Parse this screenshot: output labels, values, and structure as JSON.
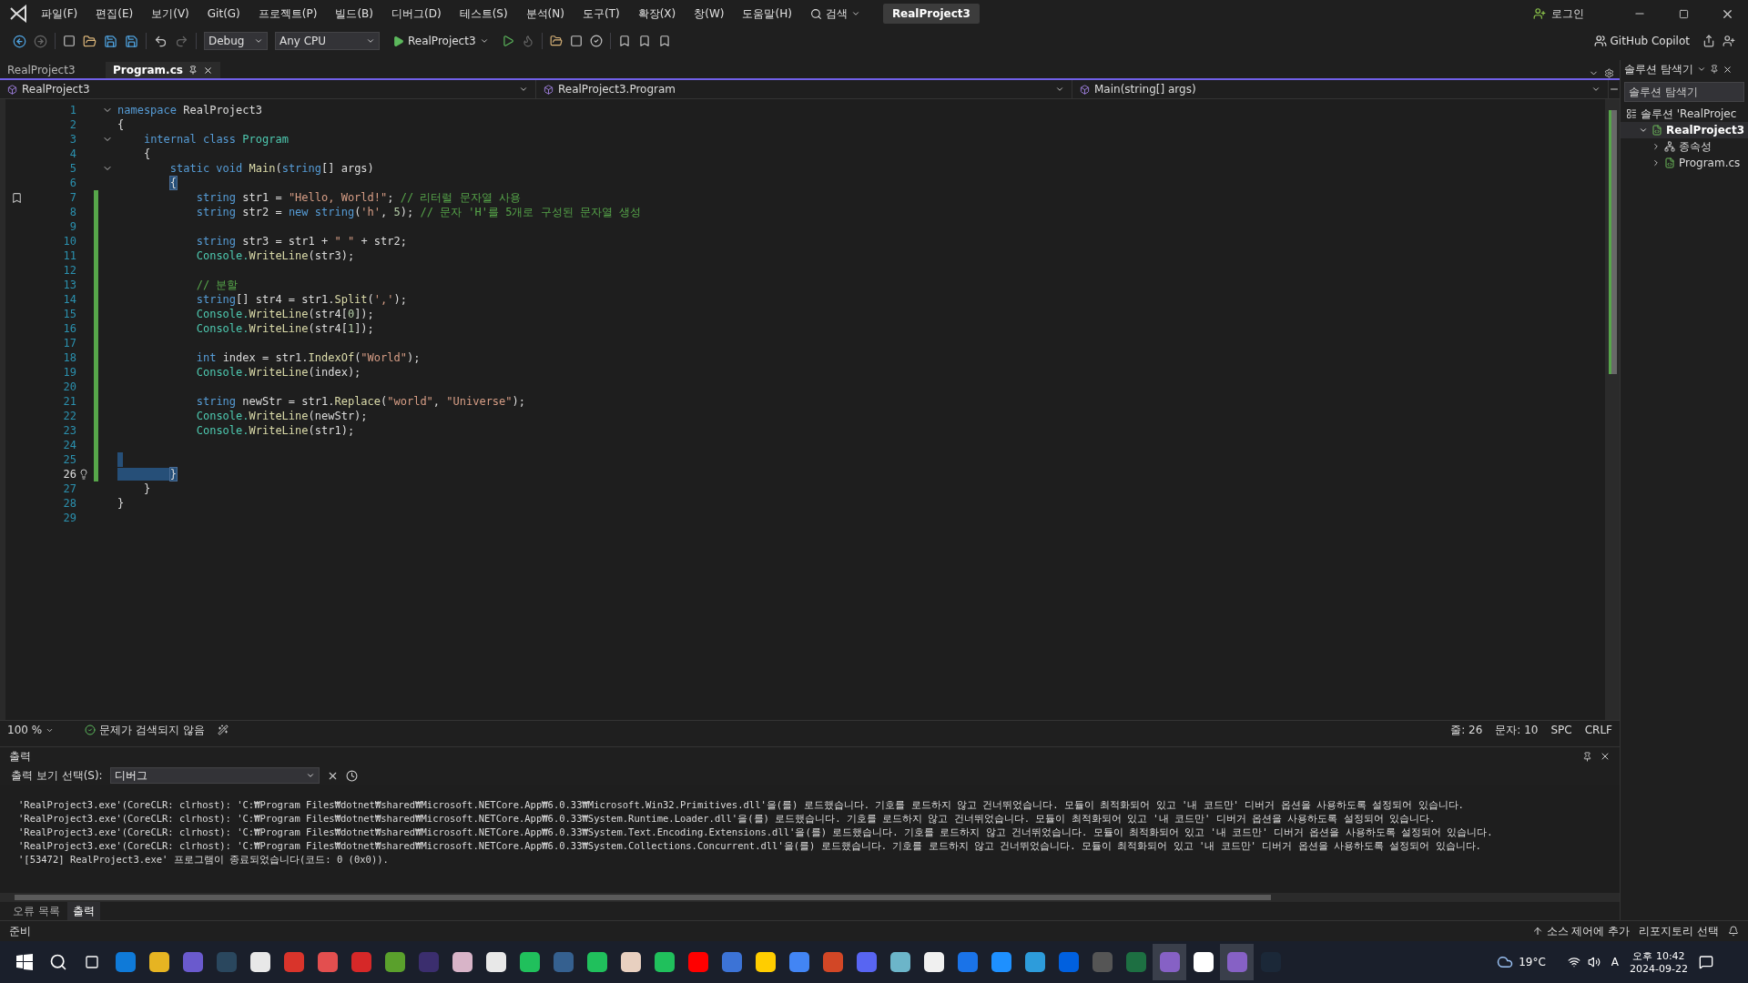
{
  "window": {
    "title": "RealProject3",
    "login": "로그인"
  },
  "menu": [
    "파일(F)",
    "편집(E)",
    "보기(V)",
    "Git(G)",
    "프로젝트(P)",
    "빌드(B)",
    "디버그(D)",
    "테스트(S)",
    "분석(N)",
    "도구(T)",
    "확장(X)",
    "창(W)",
    "도움말(H)"
  ],
  "search": {
    "label": "검색"
  },
  "toolbar": {
    "configuration": "Debug",
    "platform": "Any CPU",
    "run_target": "RealProject3",
    "copilot": "GitHub Copilot"
  },
  "doc_tabs": [
    {
      "label": "RealProject3",
      "selected": false
    },
    {
      "label": "Program.cs",
      "selected": true
    }
  ],
  "nav_bar": [
    "RealProject3",
    "RealProject3.Program",
    "Main(string[] args)"
  ],
  "code_lines": [
    {
      "n": "1",
      "changed": false,
      "selected": false,
      "foldable": true,
      "bookmark": false,
      "lightbulb": false,
      "tokens": [
        {
          "kind": "kw",
          "text": "namespace"
        },
        {
          "kind": "plain",
          "text": " RealProject3"
        }
      ]
    },
    {
      "n": "2",
      "changed": false,
      "selected": false,
      "foldable": false,
      "bookmark": false,
      "lightbulb": false,
      "tokens": [
        {
          "kind": "plain",
          "text": "{"
        }
      ]
    },
    {
      "n": "3",
      "changed": false,
      "selected": false,
      "foldable": true,
      "bookmark": false,
      "lightbulb": false,
      "tokens": [
        {
          "kind": "kw",
          "text": "    internal class"
        },
        {
          "kind": "type",
          "text": " Program"
        }
      ]
    },
    {
      "n": "4",
      "changed": false,
      "selected": false,
      "foldable": false,
      "bookmark": false,
      "lightbulb": false,
      "tokens": [
        {
          "kind": "plain",
          "text": "    {"
        }
      ]
    },
    {
      "n": "5",
      "changed": false,
      "selected": false,
      "foldable": true,
      "bookmark": false,
      "lightbulb": false,
      "tokens": [
        {
          "kind": "kw",
          "text": "        static void"
        },
        {
          "kind": "method",
          "text": " Main"
        },
        {
          "kind": "plain",
          "text": "("
        },
        {
          "kind": "kw",
          "text": "string"
        },
        {
          "kind": "plain",
          "text": "[] args)"
        }
      ]
    },
    {
      "n": "6",
      "changed": false,
      "selected": false,
      "foldable": false,
      "bookmark": false,
      "lightbulb": false,
      "tokens": [
        {
          "kind": "brace-match",
          "text": "        {"
        }
      ]
    },
    {
      "n": "7",
      "changed": true,
      "selected": false,
      "foldable": false,
      "bookmark": true,
      "lightbulb": false,
      "tokens": [
        {
          "kind": "kw",
          "text": "            string"
        },
        {
          "kind": "plain",
          "text": " str1 = "
        },
        {
          "kind": "str",
          "text": "\"Hello, World!\""
        },
        {
          "kind": "plain",
          "text": "; "
        },
        {
          "kind": "comment",
          "text": "// 리터럴 문자열 사용"
        }
      ]
    },
    {
      "n": "8",
      "changed": true,
      "selected": false,
      "foldable": false,
      "bookmark": false,
      "lightbulb": false,
      "tokens": [
        {
          "kind": "kw",
          "text": "            string"
        },
        {
          "kind": "plain",
          "text": " str2 = "
        },
        {
          "kind": "kw",
          "text": "new string"
        },
        {
          "kind": "plain",
          "text": "("
        },
        {
          "kind": "str",
          "text": "'h'"
        },
        {
          "kind": "plain",
          "text": ", "
        },
        {
          "kind": "num",
          "text": "5"
        },
        {
          "kind": "plain",
          "text": "); "
        },
        {
          "kind": "comment",
          "text": "// 문자 'H'를 5개로 구성된 문자열 생성"
        }
      ]
    },
    {
      "n": "9",
      "changed": true,
      "selected": false,
      "foldable": false,
      "bookmark": false,
      "lightbulb": false
    },
    {
      "n": "10",
      "changed": true,
      "selected": false,
      "foldable": false,
      "bookmark": false,
      "lightbulb": false,
      "tokens": [
        {
          "kind": "kw",
          "text": "            string"
        },
        {
          "kind": "plain",
          "text": " str3 = str1 + "
        },
        {
          "kind": "str",
          "text": "\" \""
        },
        {
          "kind": "plain",
          "text": " + str2;"
        }
      ]
    },
    {
      "n": "11",
      "changed": true,
      "selected": false,
      "foldable": false,
      "bookmark": false,
      "lightbulb": false,
      "tokens": [
        {
          "kind": "type",
          "text": "            Console."
        },
        {
          "kind": "method",
          "text": "WriteLine"
        },
        {
          "kind": "plain",
          "text": "(str3);"
        }
      ]
    },
    {
      "n": "12",
      "changed": true,
      "selected": false,
      "foldable": false,
      "bookmark": false,
      "lightbulb": false
    },
    {
      "n": "13",
      "changed": true,
      "selected": false,
      "foldable": false,
      "bookmark": false,
      "lightbulb": false,
      "tokens": [
        {
          "kind": "comment",
          "text": "            // 분할"
        }
      ]
    },
    {
      "n": "14",
      "changed": true,
      "selected": false,
      "foldable": false,
      "bookmark": false,
      "lightbulb": false,
      "tokens": [
        {
          "kind": "kw",
          "text": "            string"
        },
        {
          "kind": "plain",
          "text": "[] str4 = str1."
        },
        {
          "kind": "method",
          "text": "Split"
        },
        {
          "kind": "plain",
          "text": "("
        },
        {
          "kind": "str",
          "text": "','"
        },
        {
          "kind": "plain",
          "text": ");"
        }
      ]
    },
    {
      "n": "15",
      "changed": true,
      "selected": false,
      "foldable": false,
      "bookmark": false,
      "lightbulb": false,
      "tokens": [
        {
          "kind": "type",
          "text": "            Console."
        },
        {
          "kind": "method",
          "text": "WriteLine"
        },
        {
          "kind": "plain",
          "text": "(str4["
        },
        {
          "kind": "num",
          "text": "0"
        },
        {
          "kind": "plain",
          "text": "]);"
        }
      ]
    },
    {
      "n": "16",
      "changed": true,
      "selected": false,
      "foldable": false,
      "bookmark": false,
      "lightbulb": false,
      "tokens": [
        {
          "kind": "type",
          "text": "            Console."
        },
        {
          "kind": "method",
          "text": "WriteLine"
        },
        {
          "kind": "plain",
          "text": "(str4["
        },
        {
          "kind": "num",
          "text": "1"
        },
        {
          "kind": "plain",
          "text": "]);"
        }
      ]
    },
    {
      "n": "17",
      "changed": true,
      "selected": false,
      "foldable": false,
      "bookmark": false,
      "lightbulb": false
    },
    {
      "n": "18",
      "changed": true,
      "selected": false,
      "foldable": false,
      "bookmark": false,
      "lightbulb": false,
      "tokens": [
        {
          "kind": "kw",
          "text": "            int"
        },
        {
          "kind": "plain",
          "text": " index = str1."
        },
        {
          "kind": "method",
          "text": "IndexOf"
        },
        {
          "kind": "plain",
          "text": "("
        },
        {
          "kind": "str",
          "text": "\"World\""
        },
        {
          "kind": "plain",
          "text": ");"
        }
      ]
    },
    {
      "n": "19",
      "changed": true,
      "selected": false,
      "foldable": false,
      "bookmark": false,
      "lightbulb": false,
      "tokens": [
        {
          "kind": "type",
          "text": "            Console."
        },
        {
          "kind": "method",
          "text": "WriteLine"
        },
        {
          "kind": "plain",
          "text": "(index);"
        }
      ]
    },
    {
      "n": "20",
      "changed": true,
      "selected": false,
      "foldable": false,
      "bookmark": false,
      "lightbulb": false
    },
    {
      "n": "21",
      "changed": true,
      "selected": false,
      "foldable": false,
      "bookmark": false,
      "lightbulb": false,
      "tokens": [
        {
          "kind": "kw",
          "text": "            string"
        },
        {
          "kind": "plain",
          "text": " newStr = str1."
        },
        {
          "kind": "method",
          "text": "Replace"
        },
        {
          "kind": "plain",
          "text": "("
        },
        {
          "kind": "str",
          "text": "\"world\""
        },
        {
          "kind": "plain",
          "text": ", "
        },
        {
          "kind": "str",
          "text": "\"Universe\""
        },
        {
          "kind": "plain",
          "text": ");"
        }
      ]
    },
    {
      "n": "22",
      "changed": true,
      "selected": false,
      "foldable": false,
      "bookmark": false,
      "lightbulb": false,
      "tokens": [
        {
          "kind": "type",
          "text": "            Console."
        },
        {
          "kind": "method",
          "text": "WriteLine"
        },
        {
          "kind": "plain",
          "text": "(newStr);"
        }
      ]
    },
    {
      "n": "23",
      "changed": true,
      "selected": false,
      "foldable": false,
      "bookmark": false,
      "lightbulb": false,
      "tokens": [
        {
          "kind": "type",
          "text": "            Console."
        },
        {
          "kind": "method",
          "text": "WriteLine"
        },
        {
          "kind": "plain",
          "text": "(str1);"
        }
      ]
    },
    {
      "n": "24",
      "changed": true,
      "selected": false,
      "foldable": false,
      "bookmark": false,
      "lightbulb": false
    },
    {
      "n": "25",
      "changed": true,
      "selected": true,
      "foldable": false,
      "bookmark": false,
      "lightbulb": false
    },
    {
      "n": "26",
      "changed": true,
      "selected": true,
      "foldable": false,
      "bookmark": false,
      "lightbulb": true,
      "tokens": [
        {
          "kind": "brace-match",
          "text": "        }"
        }
      ]
    },
    {
      "n": "27",
      "changed": false,
      "selected": false,
      "foldable": false,
      "bookmark": false,
      "lightbulb": false,
      "tokens": [
        {
          "kind": "plain",
          "text": "    }"
        }
      ]
    },
    {
      "n": "28",
      "changed": false,
      "selected": false,
      "foldable": false,
      "bookmark": false,
      "lightbulb": false,
      "tokens": [
        {
          "kind": "plain",
          "text": "}"
        }
      ]
    },
    {
      "n": "29",
      "changed": false,
      "selected": false,
      "foldable": false,
      "bookmark": false,
      "lightbulb": false
    }
  ],
  "editor_status": {
    "zoom": "100 %",
    "issues": "문제가 검색되지 않음",
    "line": "줄: 26",
    "column": "문자: 10",
    "whitespace": "SPC",
    "line_ending": "CRLF"
  },
  "output": {
    "title": "출력",
    "source_label": "출력 보기 선택(S):",
    "source": "디버그",
    "lines": [
      "'RealProject3.exe'(CoreCLR: clrhost): 'C:₩Program Files₩dotnet₩shared₩Microsoft.NETCore.App₩6.0.33₩Microsoft.Win32.Primitives.dll'을(를) 로드했습니다. 기호를 로드하지 않고 건너뛰었습니다. 모듈이 최적화되어 있고 '내 코드만' 디버거 옵션을 사용하도록 설정되어 있습니다.",
      "'RealProject3.exe'(CoreCLR: clrhost): 'C:₩Program Files₩dotnet₩shared₩Microsoft.NETCore.App₩6.0.33₩System.Runtime.Loader.dll'을(를) 로드했습니다. 기호를 로드하지 않고 건너뛰었습니다. 모듈이 최적화되어 있고 '내 코드만' 디버거 옵션을 사용하도록 설정되어 있습니다.",
      "'RealProject3.exe'(CoreCLR: clrhost): 'C:₩Program Files₩dotnet₩shared₩Microsoft.NETCore.App₩6.0.33₩System.Text.Encoding.Extensions.dll'을(를) 로드했습니다. 기호를 로드하지 않고 건너뛰었습니다. 모듈이 최적화되어 있고 '내 코드만' 디버거 옵션을 사용하도록 설정되어 있습니다.",
      "'RealProject3.exe'(CoreCLR: clrhost): 'C:₩Program Files₩dotnet₩shared₩Microsoft.NETCore.App₩6.0.33₩System.Collections.Concurrent.dll'을(를) 로드했습니다. 기호를 로드하지 않고 건너뛰었습니다. 모듈이 최적화되어 있고 '내 코드만' 디버거 옵션을 사용하도록 설정되어 있습니다.",
      "'[53472] RealProject3.exe' 프로그램이 종료되었습니다(코드: 0 (0x0))."
    ]
  },
  "bottom_tabs": [
    {
      "label": "오류 목록",
      "selected": false
    },
    {
      "label": "출력",
      "selected": true
    }
  ],
  "solution_explorer": {
    "title": "솔루션 탐색기",
    "search_placeholder": "솔루션 탐색기",
    "tree": [
      {
        "label": "솔루션 'RealProjec",
        "kind": "solution",
        "children": [
          {
            "label": "RealProject3",
            "kind": "project",
            "expanded": true,
            "children": [
              {
                "label": "종속성",
                "kind": "dependencies",
                "expanded": false
              },
              {
                "label": "Program.cs",
                "kind": "csharp",
                "expanded": false
              }
            ]
          }
        ]
      }
    ]
  },
  "status_bar": {
    "ready": "준비",
    "source_control": "소스 제어에 추가",
    "repository": "리포지토리 선택"
  },
  "taskbar": {
    "weather": "19°C",
    "ime": "A",
    "time": "오후 10:42",
    "date": "2024-09-22"
  }
}
